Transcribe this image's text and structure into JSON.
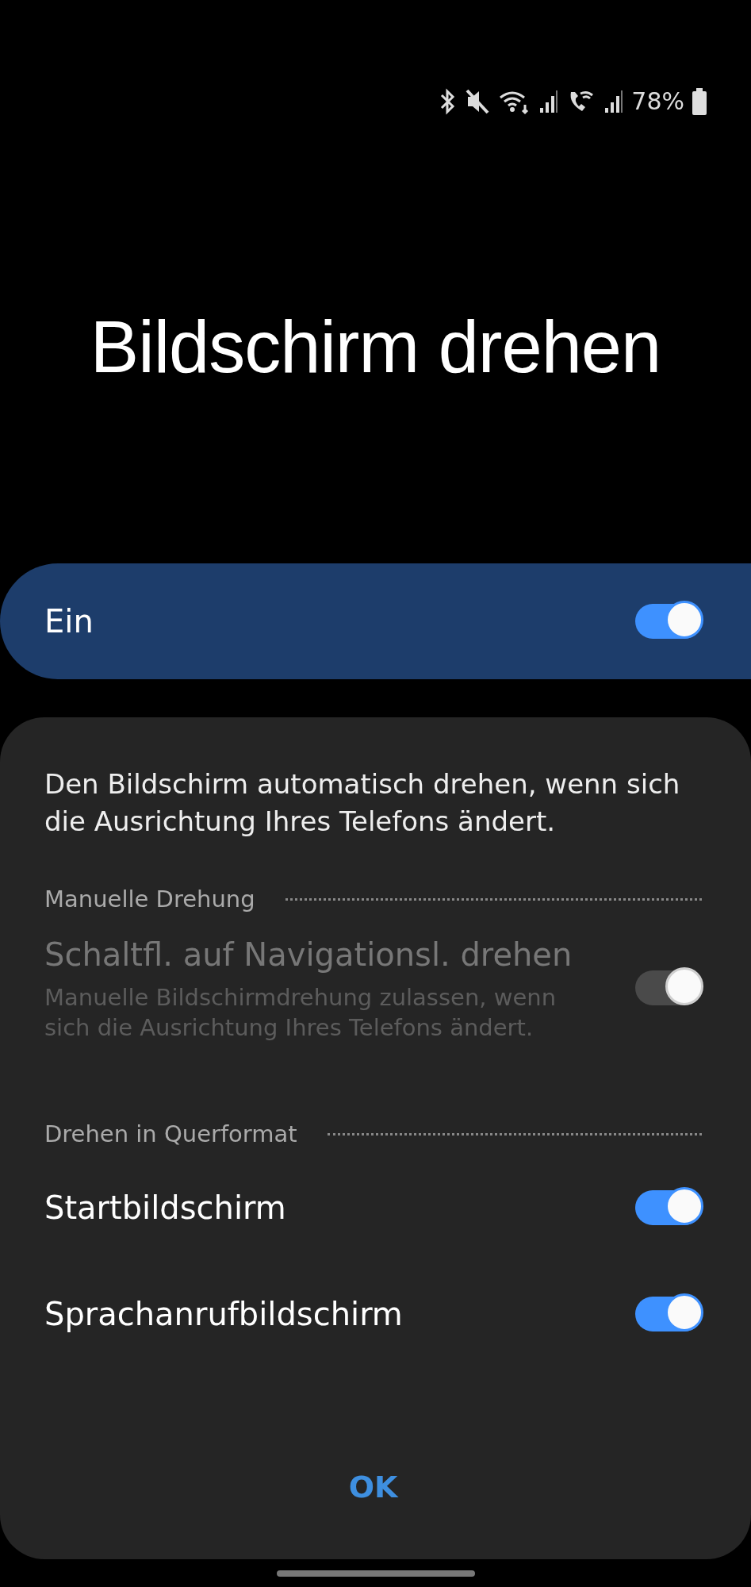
{
  "status_bar": {
    "battery": "78%"
  },
  "title": "Bildschirm drehen",
  "master": {
    "label": "Ein",
    "on": true
  },
  "description": "Den Bildschirm automatisch drehen, wenn sich die Ausrichtung Ihres Telefons ändert.",
  "sections": [
    {
      "header": "Manuelle Drehung",
      "items": [
        {
          "title": "Schaltfl. auf Navigationsl. drehen",
          "subtitle": "Manuelle Bildschirmdrehung zulassen, wenn sich die Ausrichtung Ihres Telefons ändert.",
          "on": true,
          "disabled": true
        }
      ]
    },
    {
      "header": "Drehen in Querformat",
      "items": [
        {
          "title": "Startbildschirm",
          "on": true,
          "disabled": false
        },
        {
          "title": "Sprachanrufbildschirm",
          "on": true,
          "disabled": false
        }
      ]
    }
  ],
  "button": "OK"
}
